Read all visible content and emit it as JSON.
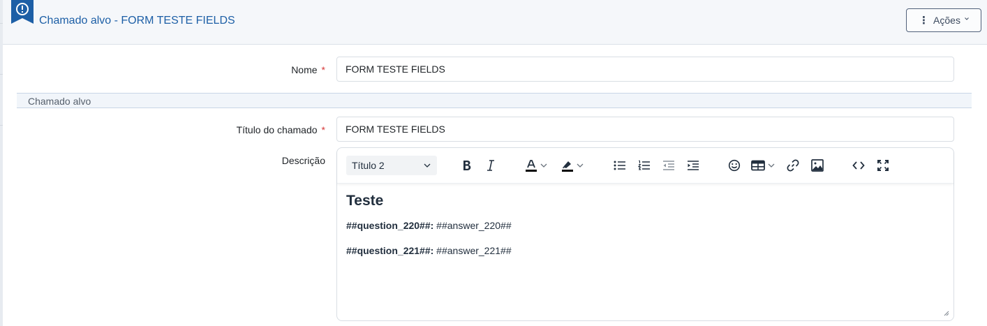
{
  "header": {
    "title": "Chamado alvo - FORM TESTE FIELDS",
    "actions_label": "Ações",
    "accent_color": "#1d5fa6"
  },
  "form": {
    "name_label": "Nome",
    "name_value": "FORM TESTE FIELDS",
    "required_mark": "*",
    "section_title": "Chamado alvo",
    "ticket_title_label": "Título do chamado",
    "ticket_title_value": "FORM TESTE FIELDS",
    "description_label": "Descrição"
  },
  "editor": {
    "block_format": "Título 2",
    "toolbar": [
      "bold-icon",
      "italic-icon",
      "text-color-icon",
      "highlight-icon",
      "bullet-list-icon",
      "numbered-list-icon",
      "outdent-icon",
      "indent-icon",
      "emoji-icon",
      "table-icon",
      "link-icon",
      "image-icon",
      "source-code-icon",
      "fullscreen-icon"
    ],
    "content": {
      "heading": "Teste",
      "lines": [
        {
          "question": "##question_220##:",
          "answer": " ##answer_220##"
        },
        {
          "question": "##question_221##:",
          "answer": " ##answer_221##"
        }
      ]
    }
  }
}
